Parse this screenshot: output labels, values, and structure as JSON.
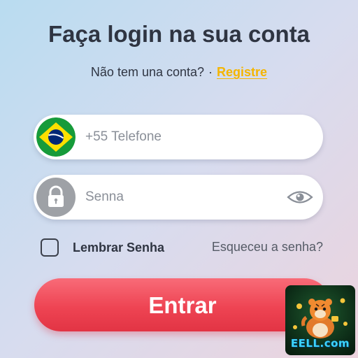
{
  "header": {
    "title": "Faça login na sua conta",
    "subtitle_text": "Não tem una conta?",
    "separator": "·",
    "register_link": "Registre"
  },
  "phone": {
    "placeholder": "+55 Telefone",
    "flag_icon": "brazil-flag-icon"
  },
  "password": {
    "placeholder": "Senna",
    "lock_icon": "lock-icon",
    "eye_icon": "eye-icon"
  },
  "options": {
    "remember_label": "Lembrar Senha",
    "remember_checked": false,
    "forgot_link": "Esqueceu a senha?"
  },
  "submit": {
    "label": "Entrar"
  },
  "watermark": {
    "text": "EELL.com"
  },
  "colors": {
    "register_link": "#f4b500",
    "submit_button": "#ee4453",
    "text_dark": "#2f3542",
    "watermark_text": "#3bd4ff"
  }
}
